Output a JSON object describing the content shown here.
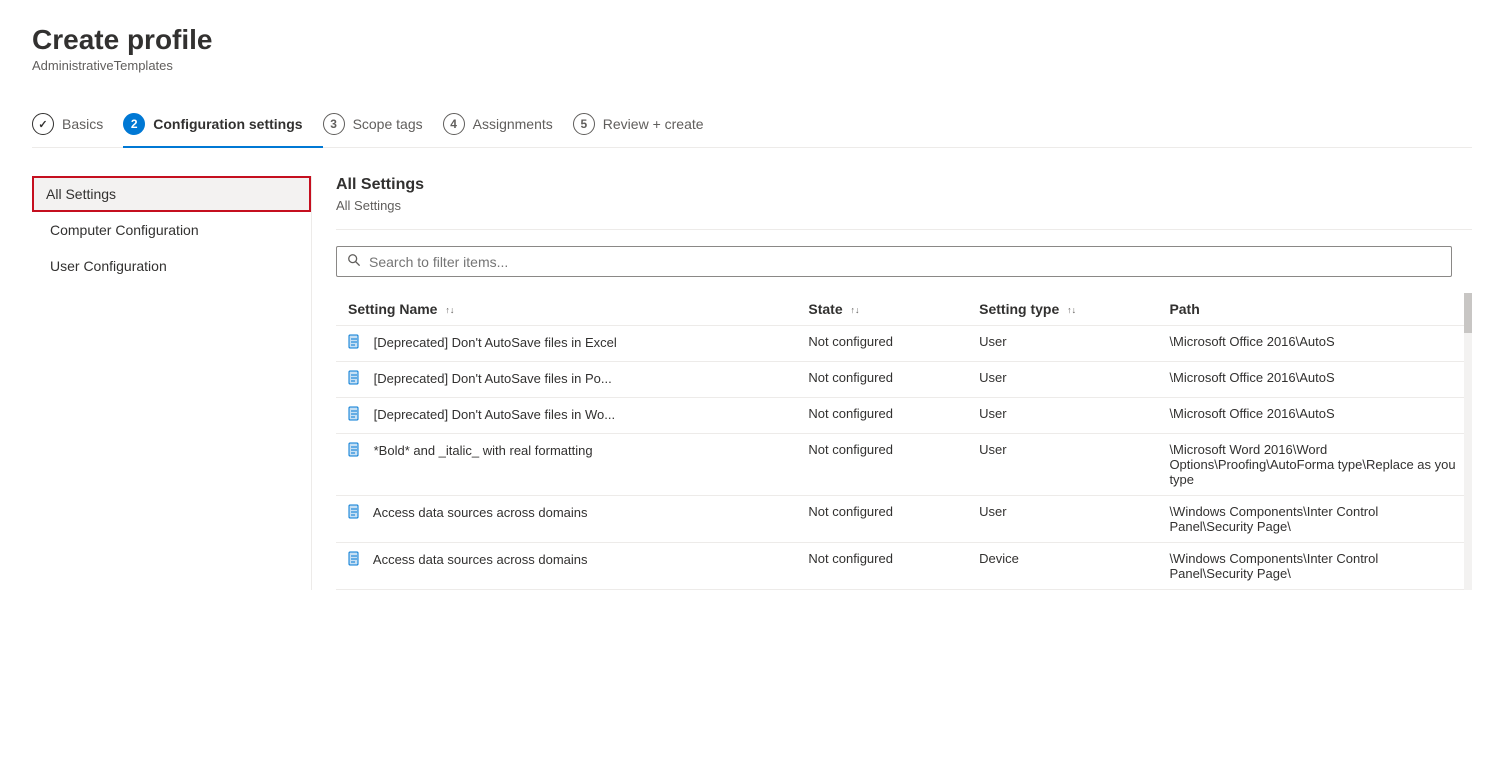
{
  "page": {
    "title": "Create profile",
    "subtitle": "AdministrativeTemplates"
  },
  "steps": [
    {
      "id": "basics",
      "number": "✓",
      "label": "Basics",
      "state": "completed"
    },
    {
      "id": "config",
      "number": "2",
      "label": "Configuration settings",
      "state": "active"
    },
    {
      "id": "scope",
      "number": "3",
      "label": "Scope tags",
      "state": "inactive"
    },
    {
      "id": "assignments",
      "number": "4",
      "label": "Assignments",
      "state": "inactive"
    },
    {
      "id": "review",
      "number": "5",
      "label": "Review + create",
      "state": "inactive"
    }
  ],
  "sidebar": {
    "items": [
      {
        "id": "all-settings",
        "label": "All Settings",
        "selected": true,
        "sub": false
      },
      {
        "id": "computer-config",
        "label": "Computer Configuration",
        "selected": false,
        "sub": true
      },
      {
        "id": "user-config",
        "label": "User Configuration",
        "selected": false,
        "sub": true
      }
    ]
  },
  "main": {
    "section_title": "All Settings",
    "breadcrumb": "All Settings",
    "search_placeholder": "Search to filter items...",
    "columns": [
      {
        "id": "setting-name",
        "label": "Setting Name"
      },
      {
        "id": "state",
        "label": "State"
      },
      {
        "id": "setting-type",
        "label": "Setting type"
      },
      {
        "id": "path",
        "label": "Path"
      }
    ],
    "rows": [
      {
        "setting_name": "[Deprecated] Don't AutoSave files in Excel",
        "state": "Not configured",
        "setting_type": "User",
        "path": "\\Microsoft Office 2016\\AutoS"
      },
      {
        "setting_name": "[Deprecated] Don't AutoSave files in Po...",
        "state": "Not configured",
        "setting_type": "User",
        "path": "\\Microsoft Office 2016\\AutoS"
      },
      {
        "setting_name": "[Deprecated] Don't AutoSave files in Wo...",
        "state": "Not configured",
        "setting_type": "User",
        "path": "\\Microsoft Office 2016\\AutoS"
      },
      {
        "setting_name": "*Bold* and _italic_ with real formatting",
        "state": "Not configured",
        "setting_type": "User",
        "path": "\\Microsoft Word 2016\\Word Options\\Proofing\\AutoForma type\\Replace as you type"
      },
      {
        "setting_name": "Access data sources across domains",
        "state": "Not configured",
        "setting_type": "User",
        "path": "\\Windows Components\\Inter Control Panel\\Security Page\\"
      },
      {
        "setting_name": "Access data sources across domains",
        "state": "Not configured",
        "setting_type": "Device",
        "path": "\\Windows Components\\Inter Control Panel\\Security Page\\"
      }
    ]
  }
}
